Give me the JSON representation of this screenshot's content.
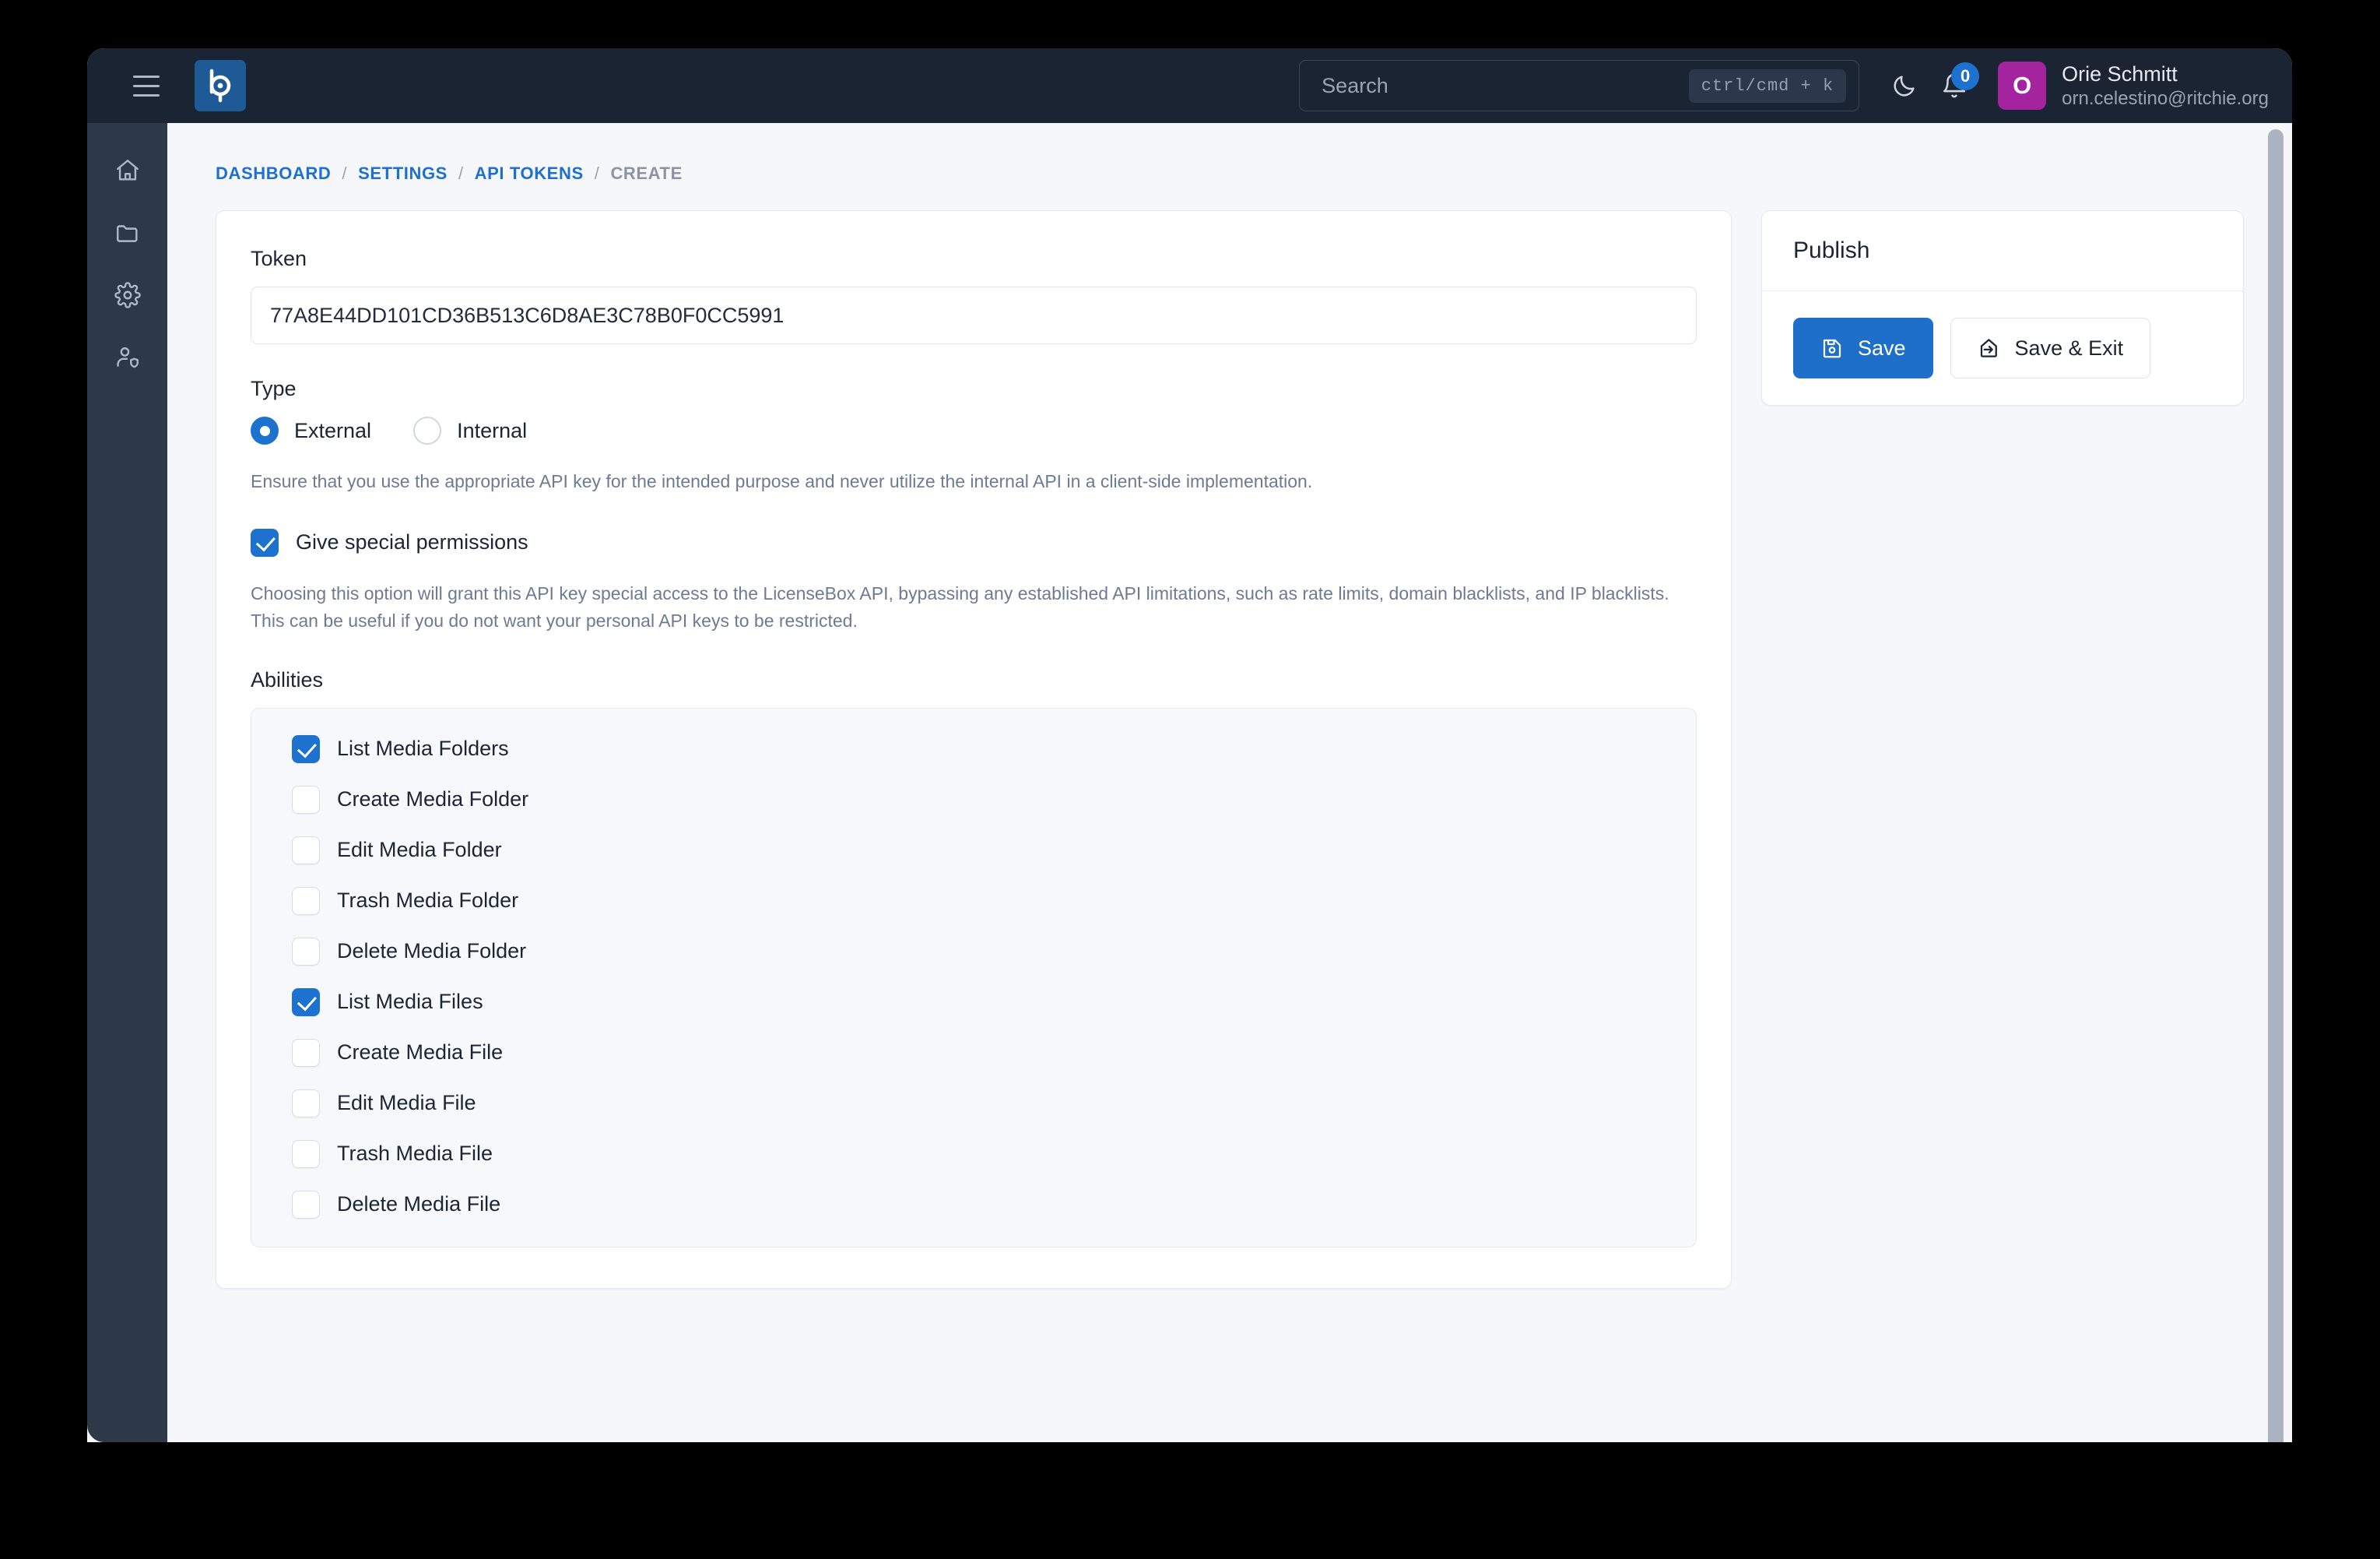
{
  "topbar": {
    "menu_icon": "hamburger-icon",
    "logo_icon": "brand-logo-b",
    "search": {
      "placeholder": "Search",
      "kbd": "ctrl/cmd + k"
    },
    "theme_toggle_icon": "moon-icon",
    "notifications_icon": "bell-icon",
    "notifications_count": "0",
    "user": {
      "avatar_initial": "O",
      "name": "Orie Schmitt",
      "email": "orn.celestino@ritchie.org",
      "avatar_color": "#a4239f"
    }
  },
  "sidebar": {
    "items": [
      {
        "name": "home",
        "icon": "home-icon"
      },
      {
        "name": "media",
        "icon": "folder-icon"
      },
      {
        "name": "settings",
        "icon": "gear-icon"
      },
      {
        "name": "permissions",
        "icon": "user-shield-icon"
      }
    ]
  },
  "breadcrumb": {
    "items": [
      {
        "label": "DASHBOARD",
        "current": false
      },
      {
        "label": "SETTINGS",
        "current": false
      },
      {
        "label": "API TOKENS",
        "current": false
      },
      {
        "label": "CREATE",
        "current": true
      }
    ],
    "separator": "/"
  },
  "form": {
    "token": {
      "label": "Token",
      "value": "77A8E44DD101CD36B513C6D8AE3C78B0F0CC5991",
      "placeholder": "Token"
    },
    "type": {
      "label": "Type",
      "options": [
        {
          "label": "External",
          "checked": true
        },
        {
          "label": "Internal",
          "checked": false
        }
      ],
      "helper": "Ensure that you use the appropriate API key for the intended purpose and never utilize the internal API in a client-side implementation."
    },
    "special_permissions": {
      "label": "Give special permissions",
      "checked": true,
      "helper": "Choosing this option will grant this API key special access to the LicenseBox API, bypassing any established API limitations, such as rate limits, domain blacklists, and IP blacklists. This can be useful if you do not want your personal API keys to be restricted."
    },
    "abilities": {
      "label": "Abilities",
      "items": [
        {
          "label": "List Media Folders",
          "checked": true
        },
        {
          "label": "Create Media Folder",
          "checked": false
        },
        {
          "label": "Edit Media Folder",
          "checked": false
        },
        {
          "label": "Trash Media Folder",
          "checked": false
        },
        {
          "label": "Delete Media Folder",
          "checked": false
        },
        {
          "label": "List Media Files",
          "checked": true
        },
        {
          "label": "Create Media File",
          "checked": false
        },
        {
          "label": "Edit Media File",
          "checked": false
        },
        {
          "label": "Trash Media File",
          "checked": false
        },
        {
          "label": "Delete Media File",
          "checked": false
        }
      ]
    }
  },
  "publish": {
    "title": "Publish",
    "save_label": "Save",
    "save_icon": "floppy-disk-icon",
    "save_exit_label": "Save & Exit",
    "save_exit_icon": "exit-arrow-icon"
  },
  "colors": {
    "accent": "#1d6fc9",
    "topbar_bg": "#1b2433",
    "sidebar_bg": "#2d3848",
    "content_bg": "#f5f7fb",
    "breadcrumb_link": "#1f6fd0"
  }
}
